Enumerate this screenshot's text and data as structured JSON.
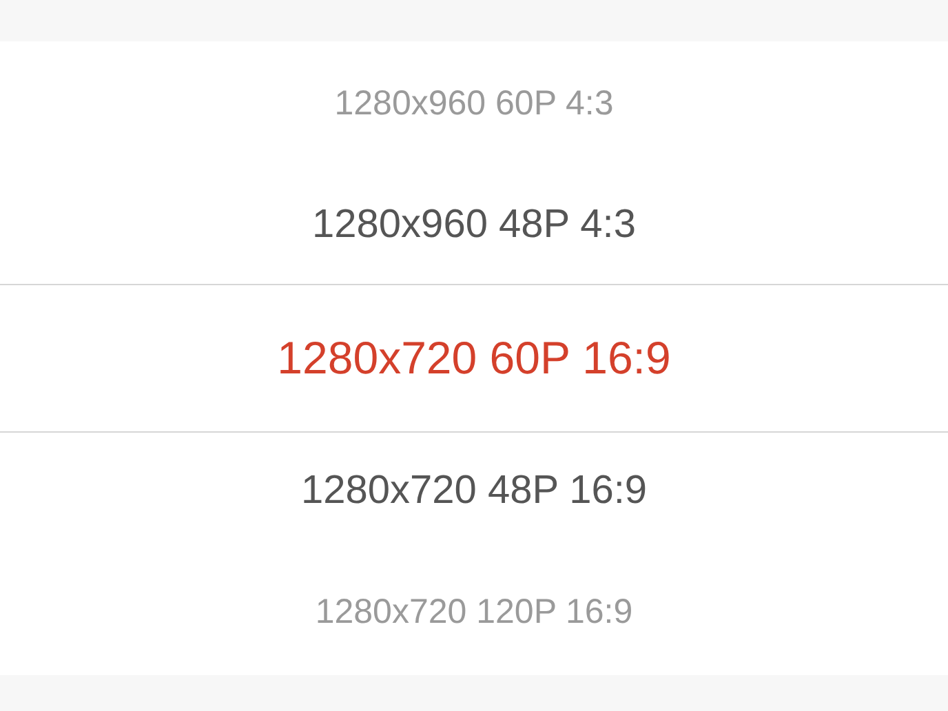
{
  "picker": {
    "items": [
      {
        "label": "1280x960 60P 4:3",
        "selected": false
      },
      {
        "label": "1280x960 48P 4:3",
        "selected": false
      },
      {
        "label": "1280x720 60P 16:9",
        "selected": true
      },
      {
        "label": "1280x720 48P 16:9",
        "selected": false
      },
      {
        "label": "1280x720 120P 16:9",
        "selected": false
      }
    ]
  }
}
